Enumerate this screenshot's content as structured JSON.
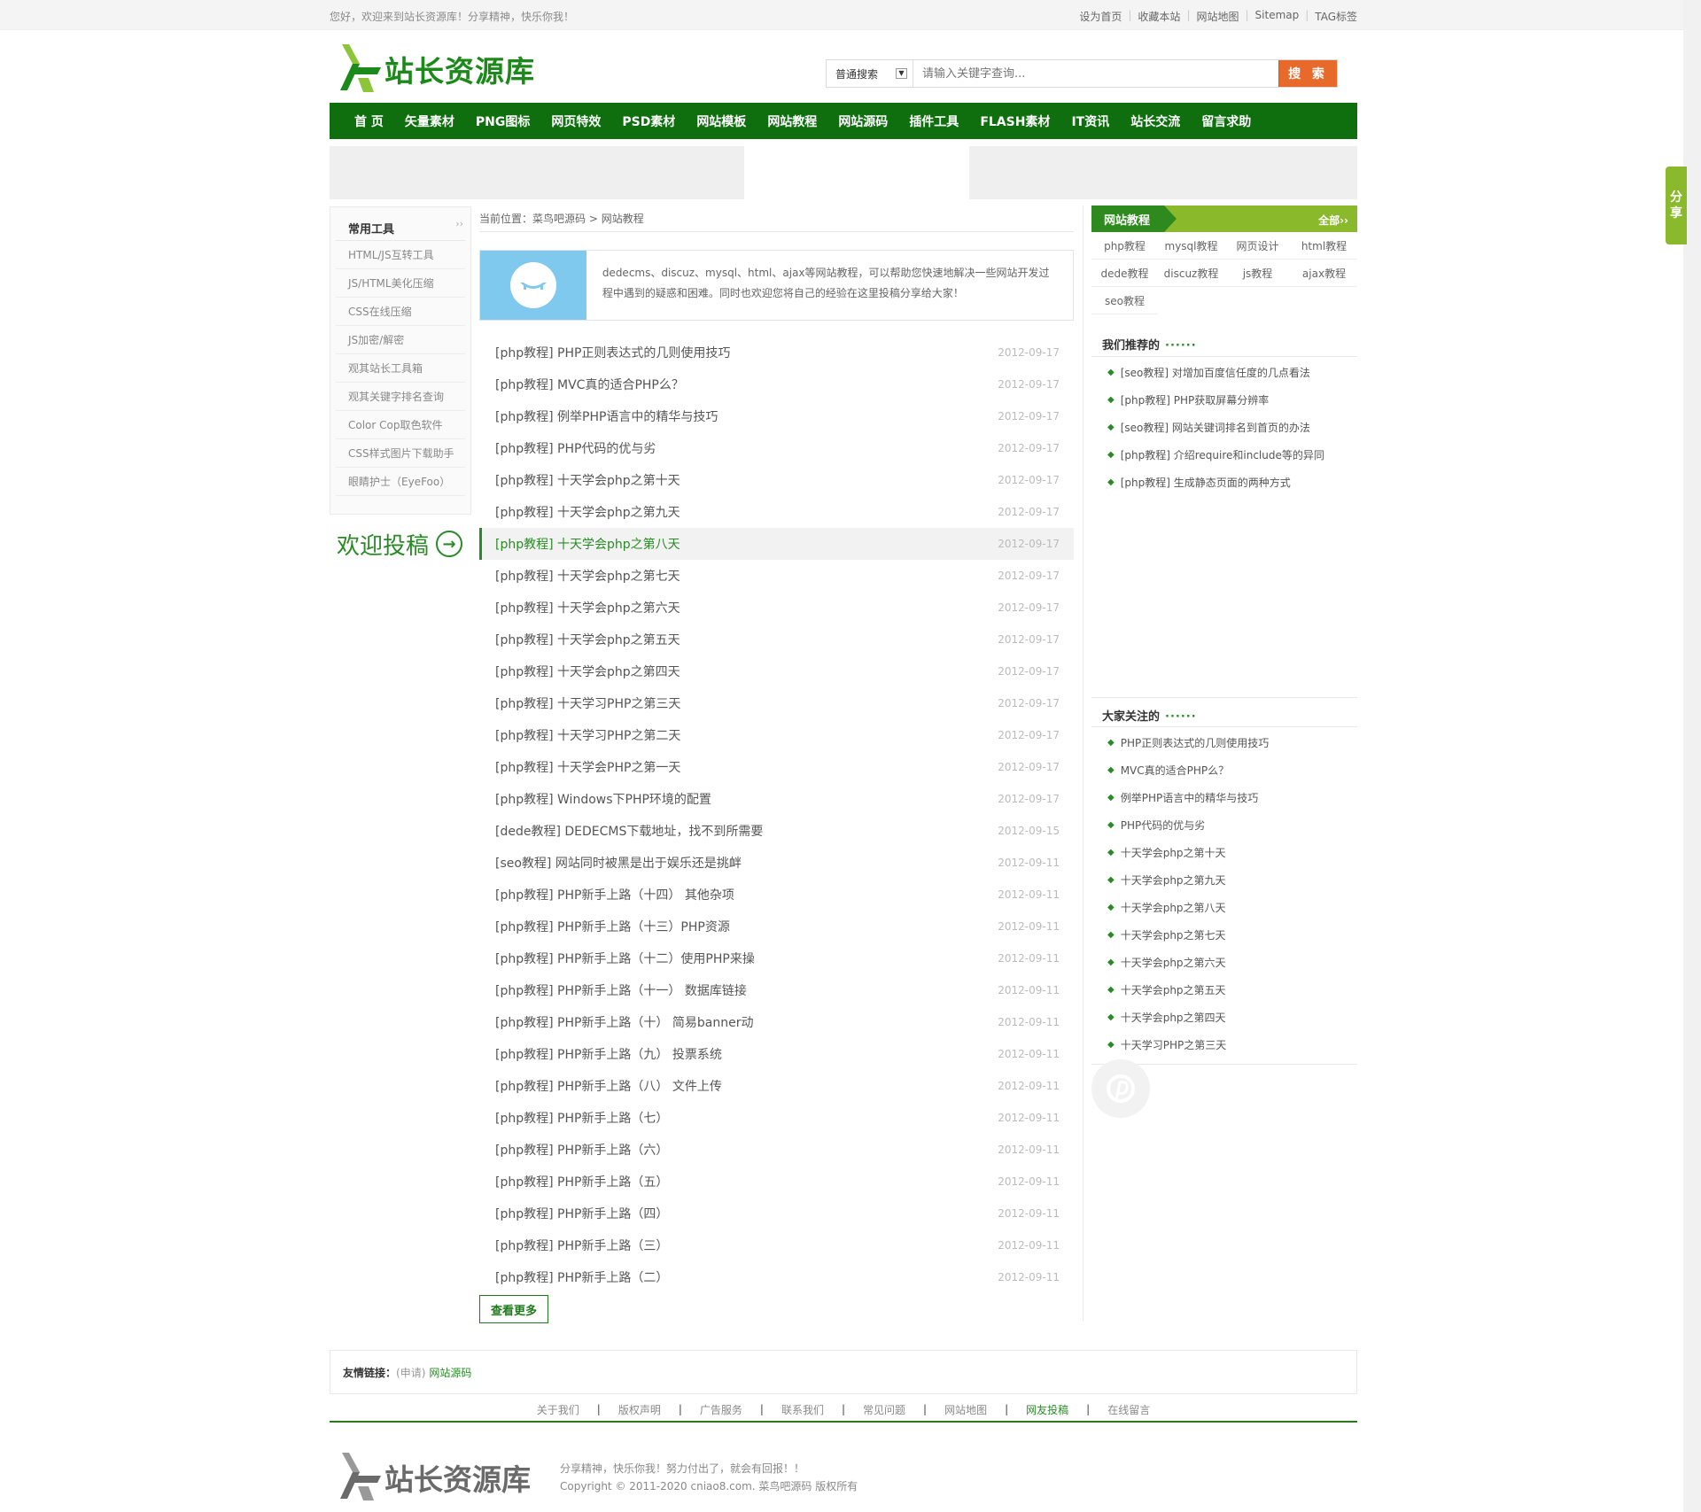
{
  "top": {
    "welcome": "您好，欢迎来到站长资源库！分享精神，快乐你我！",
    "links": [
      "设为首页",
      "收藏本站",
      "网站地图",
      "Sitemap",
      "TAG标签"
    ]
  },
  "brand": {
    "name": "站长资源库",
    "color": "#1c8a1a"
  },
  "search": {
    "scope": "普通搜索",
    "placeholder": "请输入关键字查询...",
    "button": "搜 索"
  },
  "nav": [
    "首 页",
    "矢量素材",
    "PNG图标",
    "网页特效",
    "PSD素材",
    "网站模板",
    "网站教程",
    "网站源码",
    "插件工具",
    "FLASH素材",
    "IT资讯",
    "站长交流",
    "留言求助"
  ],
  "tools": {
    "title": "常用工具",
    "more": "››",
    "items": [
      "HTML/JS互转工具",
      "JS/HTML美化压缩",
      "CSS在线压缩",
      "JS加密/解密",
      "观其站长工具箱",
      "观其关键字排名查询",
      "Color Cop取色软件",
      "CSS样式图片下载助手",
      "眼睛护士（EyeFoo）"
    ]
  },
  "submit": {
    "label": "欢迎投稿",
    "icon": "arrow-right-circle-icon"
  },
  "breadcrumb": {
    "prefix": "当前位置：",
    "home": "菜鸟吧源码",
    "sep": ">",
    "current": "网站教程"
  },
  "intro": {
    "text": "dedecms、discuz、mysql、html、ajax等网站教程，可以帮助您快速地解决一些网站开发过程中遇到的疑惑和困难。同时也欢迎您将自己的经验在这里投稿分享给大家！"
  },
  "articles": [
    {
      "title": "[php教程] PHP正则表达式的几则使用技巧",
      "date": "2012-09-17"
    },
    {
      "title": "[php教程] MVC真的适合PHP么？",
      "date": "2012-09-17"
    },
    {
      "title": "[php教程] 例举PHP语言中的精华与技巧",
      "date": "2012-09-17"
    },
    {
      "title": "[php教程] PHP代码的优与劣",
      "date": "2012-09-17"
    },
    {
      "title": "[php教程] 十天学会php之第十天",
      "date": "2012-09-17"
    },
    {
      "title": "[php教程] 十天学会php之第九天",
      "date": "2012-09-17"
    },
    {
      "title": "[php教程] 十天学会php之第八天",
      "date": "2012-09-17",
      "active": true
    },
    {
      "title": "[php教程] 十天学会php之第七天",
      "date": "2012-09-17"
    },
    {
      "title": "[php教程] 十天学会php之第六天",
      "date": "2012-09-17"
    },
    {
      "title": "[php教程] 十天学会php之第五天",
      "date": "2012-09-17"
    },
    {
      "title": "[php教程] 十天学会php之第四天",
      "date": "2012-09-17"
    },
    {
      "title": "[php教程] 十天学习PHP之第三天",
      "date": "2012-09-17"
    },
    {
      "title": "[php教程] 十天学习PHP之第二天",
      "date": "2012-09-17"
    },
    {
      "title": "[php教程] 十天学会PHP之第一天",
      "date": "2012-09-17"
    },
    {
      "title": "[php教程] Windows下PHP环境的配置",
      "date": "2012-09-17"
    },
    {
      "title": "[dede教程] DEDECMS下载地址，找不到所需要",
      "date": "2012-09-15"
    },
    {
      "title": "[seo教程] 网站同时被黑是出于娱乐还是挑衅",
      "date": "2012-09-11"
    },
    {
      "title": "[php教程] PHP新手上路（十四） 其他杂项",
      "date": "2012-09-11"
    },
    {
      "title": "[php教程] PHP新手上路（十三）PHP资源",
      "date": "2012-09-11"
    },
    {
      "title": "[php教程] PHP新手上路（十二）使用PHP来操",
      "date": "2012-09-11"
    },
    {
      "title": "[php教程] PHP新手上路（十一） 数据库链接",
      "date": "2012-09-11"
    },
    {
      "title": "[php教程] PHP新手上路（十） 简易banner动",
      "date": "2012-09-11"
    },
    {
      "title": "[php教程] PHP新手上路（九） 投票系统",
      "date": "2012-09-11"
    },
    {
      "title": "[php教程] PHP新手上路（八） 文件上传",
      "date": "2012-09-11"
    },
    {
      "title": "[php教程] PHP新手上路（七）",
      "date": "2012-09-11"
    },
    {
      "title": "[php教程] PHP新手上路（六）",
      "date": "2012-09-11"
    },
    {
      "title": "[php教程] PHP新手上路（五）",
      "date": "2012-09-11"
    },
    {
      "title": "[php教程] PHP新手上路（四）",
      "date": "2012-09-11"
    },
    {
      "title": "[php教程] PHP新手上路（三）",
      "date": "2012-09-11"
    },
    {
      "title": "[php教程] PHP新手上路（二）",
      "date": "2012-09-11"
    }
  ],
  "more_button": "查看更多",
  "right": {
    "tab": "网站教程",
    "all": "全部››",
    "tags": [
      "php教程",
      "mysql教程",
      "网页设计",
      "html教程",
      "dede教程",
      "discuz教程",
      "js教程",
      "ajax教程",
      "seo教程"
    ],
    "recommend_title": "我们推荐的",
    "recommend": [
      "[seo教程] 对增加百度信任度的几点看法",
      "[php教程] PHP获取屏幕分辨率",
      "[seo教程] 网站关键词排名到首页的办法",
      "[php教程] 介绍require和include等的异同",
      "[php教程] 生成静态页面的两种方式"
    ],
    "popular_title": "大家关注的",
    "popular": [
      "PHP正则表达式的几则使用技巧",
      "MVC真的适合PHP么？",
      "例举PHP语言中的精华与技巧",
      "PHP代码的优与劣",
      "十天学会php之第十天",
      "十天学会php之第九天",
      "十天学会php之第八天",
      "十天学会php之第七天",
      "十天学会php之第六天",
      "十天学会php之第五天",
      "十天学会php之第四天",
      "十天学习PHP之第三天"
    ],
    "dots": "······"
  },
  "share": {
    "line1": "分",
    "line2": "享"
  },
  "footer": {
    "links_label": "友情链接：",
    "apply": "(申请)",
    "link1": "网站源码",
    "nav": [
      "关于我们",
      "版权声明",
      "广告服务",
      "联系我们",
      "常见问题",
      "网站地图",
      "网友投稿",
      "在线留言"
    ],
    "slogan": "分享精神，快乐你我！努力付出了，就会有回报！！",
    "copyright": "Copyright © 2011-2020 cniao8.com. 菜鸟吧源码 版权所有"
  }
}
